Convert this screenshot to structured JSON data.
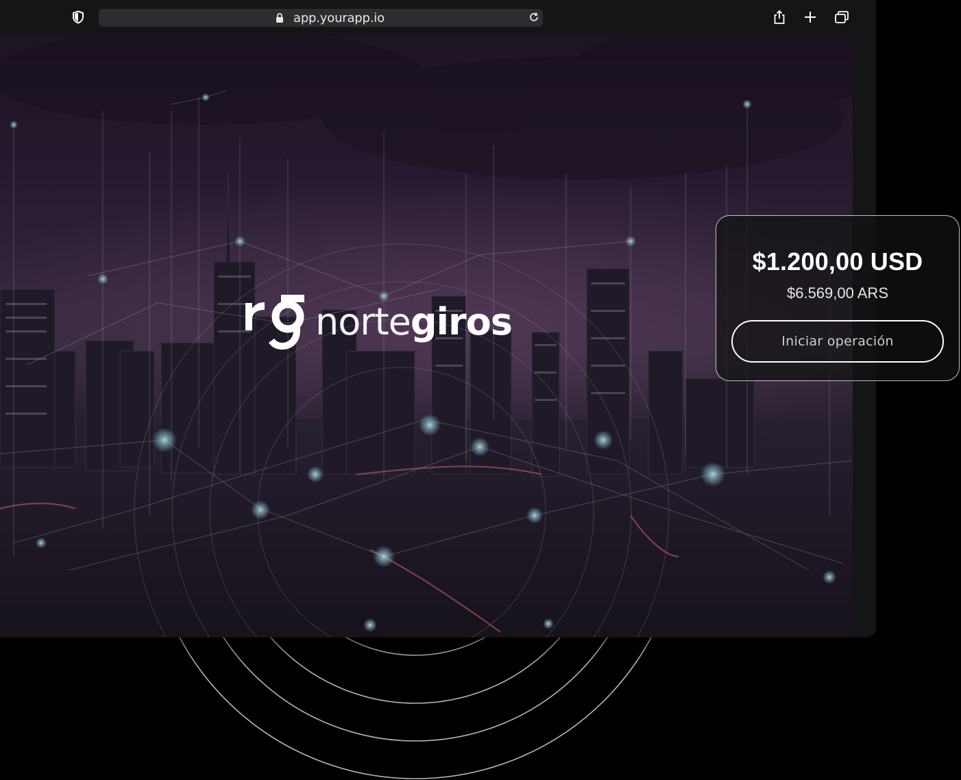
{
  "browser": {
    "url": "app.yourapp.io",
    "icons": {
      "shield": "shield-icon",
      "lock": "lock-icon",
      "reload": "reload-icon",
      "share": "share-icon",
      "new_tab": "plus-icon",
      "tabs": "tabs-icon"
    }
  },
  "brand": {
    "mark": "rg",
    "word_light": "norte",
    "word_bold": "giros"
  },
  "quote": {
    "amount_usd": "$1.200,00 USD",
    "amount_ars": "$6.569,00 ARS",
    "cta_label": "Iniciar operación"
  },
  "colors": {
    "page_bg": "#000000",
    "window_bg": "#141516",
    "address_bar": "#2b2d30",
    "text_primary": "#ffffff",
    "glow": "#9fe3f0"
  }
}
